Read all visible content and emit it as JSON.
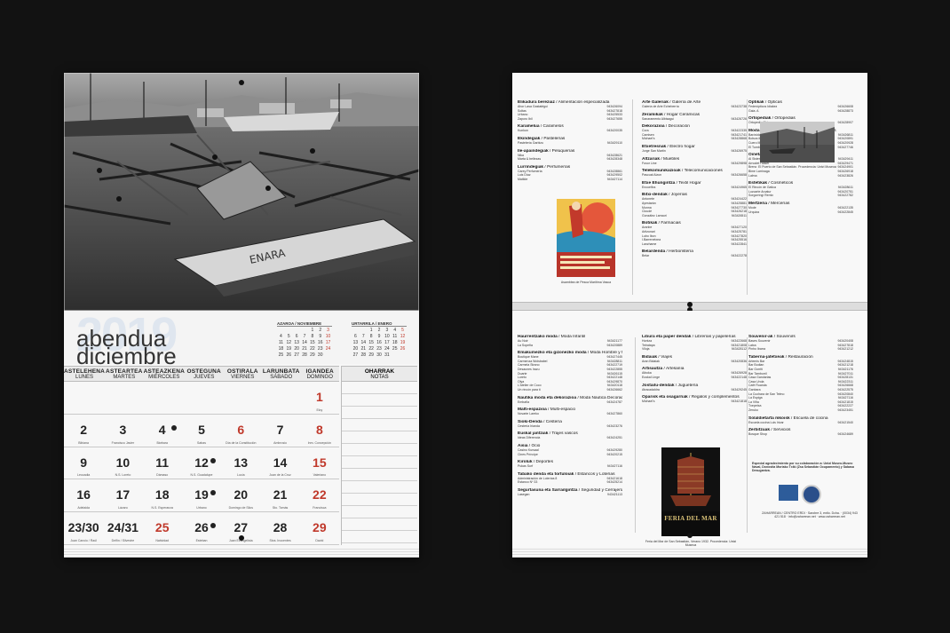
{
  "calendar": {
    "year": "2019",
    "month_eu": "abendua",
    "month_es": "diciembre",
    "mini_prev": {
      "title": "AZAROA / NOVIEMBRE",
      "rows": [
        [
          "",
          "",
          "",
          "",
          "1",
          "2",
          "3"
        ],
        [
          "4",
          "5",
          "6",
          "7",
          "8",
          "9",
          "10"
        ],
        [
          "11",
          "12",
          "13",
          "14",
          "15",
          "16",
          "17"
        ],
        [
          "18",
          "19",
          "20",
          "21",
          "22",
          "23",
          "24"
        ],
        [
          "25",
          "26",
          "27",
          "28",
          "29",
          "30",
          ""
        ]
      ]
    },
    "mini_next": {
      "title": "URTARRILA / ENERO",
      "rows": [
        [
          "",
          "",
          "1",
          "2",
          "3",
          "4",
          "5"
        ],
        [
          "6",
          "7",
          "8",
          "9",
          "10",
          "11",
          "12"
        ],
        [
          "13",
          "14",
          "15",
          "16",
          "17",
          "18",
          "19"
        ],
        [
          "20",
          "21",
          "22",
          "23",
          "24",
          "25",
          "26"
        ],
        [
          "27",
          "28",
          "29",
          "30",
          "31",
          "",
          ""
        ]
      ]
    },
    "weekdays": [
      {
        "eu": "ASTELEHENA",
        "es": "LUNES"
      },
      {
        "eu": "ASTEARTEA",
        "es": "MARTES"
      },
      {
        "eu": "ASTEAZKENA",
        "es": "MIÉRCOLES"
      },
      {
        "eu": "OSTEGUNA",
        "es": "JUEVES"
      },
      {
        "eu": "OSTIRALA",
        "es": "VIERNES"
      },
      {
        "eu": "LARUNBATA",
        "es": "SÁBADO"
      },
      {
        "eu": "IGANDEA",
        "es": "DOMINGO"
      }
    ],
    "notes": {
      "eu": "OHARRAK",
      "es": "NOTAS"
    },
    "days": [
      {
        "n": "",
        "s": ""
      },
      {
        "n": "",
        "s": ""
      },
      {
        "n": "",
        "s": ""
      },
      {
        "n": "",
        "s": ""
      },
      {
        "n": "",
        "s": ""
      },
      {
        "n": "",
        "s": ""
      },
      {
        "n": "1",
        "s": "Eloy"
      },
      {
        "n": "2",
        "s": "Bibiana"
      },
      {
        "n": "3",
        "s": "Francisco Javier"
      },
      {
        "n": "4",
        "s": "Bárbara"
      },
      {
        "n": "5",
        "s": "Sabas"
      },
      {
        "n": "6",
        "s": "Día de la Constitución"
      },
      {
        "n": "7",
        "s": "Ambrosio"
      },
      {
        "n": "8",
        "s": "Inm. Concepción"
      },
      {
        "n": "9",
        "s": "Leocadia"
      },
      {
        "n": "10",
        "s": "N.S. Loreto"
      },
      {
        "n": "11",
        "s": "Dámaso"
      },
      {
        "n": "12",
        "s": "N.S. Guadalupe"
      },
      {
        "n": "13",
        "s": "Lucía"
      },
      {
        "n": "14",
        "s": "Juan de la Cruz"
      },
      {
        "n": "15",
        "s": "Valeriano"
      },
      {
        "n": "16",
        "s": "Adelaida"
      },
      {
        "n": "17",
        "s": "Lázaro"
      },
      {
        "n": "18",
        "s": "N.S. Esperanza"
      },
      {
        "n": "19",
        "s": "Urbano"
      },
      {
        "n": "20",
        "s": "Domingo de Silos"
      },
      {
        "n": "21",
        "s": "Sto. Tomás"
      },
      {
        "n": "22",
        "s": "Francisca"
      },
      {
        "n": "23/30",
        "s": "Juan Cancio / Raúl"
      },
      {
        "n": "24/31",
        "s": "Delfín / Silvestre"
      },
      {
        "n": "25",
        "s": "Natividad"
      },
      {
        "n": "26",
        "s": "Esteban"
      },
      {
        "n": "27",
        "s": "Juan Evangelista"
      },
      {
        "n": "28",
        "s": "Stos. Inocentes"
      },
      {
        "n": "29",
        "s": "David"
      }
    ]
  },
  "directory": {
    "col1": [
      {
        "cat": "Elikadura bereziaz",
        "sub": "Alimentación especializada",
        "rows": [
          [
            "Ahor Lasa Gastatégui",
            "943426094"
          ],
          [
            "Soltas",
            "943427818"
          ],
          [
            "Urbano",
            "943425533"
          ],
          [
            "Zaporo Ibil",
            "943427655"
          ]
        ]
      },
      {
        "cat": "Karamelua",
        "sub": "Caramelos",
        "rows": [
          [
            "Kunkun",
            "943420035"
          ]
        ]
      },
      {
        "cat": "Ekindegiak",
        "sub": "Pastelerías",
        "rows": [
          [
            "Pastelería Garbizu",
            "943429110"
          ]
        ]
      },
      {
        "cat": "Ile-apaindegiak",
        "sub": "Peluquerías",
        "rows": [
          [
            "Nika",
            "943428621"
          ],
          [
            "Marta & bellezas",
            "943428348"
          ]
        ]
      },
      {
        "cat": "Lurrindegiak",
        "sub": "Perfumerías",
        "rows": [
          [
            "Carey Perfumería",
            "943428861"
          ],
          [
            "Luis Díaz",
            "943429502"
          ],
          [
            "Matilde",
            "943427114"
          ]
        ]
      }
    ],
    "col2": [
      {
        "cat": "Arte Galeriak",
        "sub": "Galería de Arte",
        "rows": [
          [
            "Galería de Arte Echeberría",
            "943423738"
          ]
        ]
      },
      {
        "cat": "Zeramikak",
        "sub": "Hogar Cerámicas",
        "rows": [
          [
            "Sanaramento Albisagui",
            "943426726"
          ]
        ]
      },
      {
        "cat": "Dekorazioa",
        "sub": "Decoración",
        "rows": [
          [
            "Cora",
            "943422335"
          ],
          [
            "Camisen",
            "943421741"
          ],
          [
            "Michael's",
            "943428868"
          ]
        ]
      },
      {
        "cat": "Etxetresnak",
        "sub": "Electro hogar",
        "rows": [
          [
            "Jorge San Martín",
            "943426975"
          ]
        ]
      },
      {
        "cat": "Altzariak",
        "sub": "Muebles",
        "rows": [
          [
            "Fusor Line",
            "943429898"
          ]
        ]
      },
      {
        "cat": "Telekomunikazioak",
        "sub": "Telecomunicaciones",
        "rows": [
          [
            "Pascual Aizun",
            "943426658"
          ]
        ]
      },
      {
        "cat": "Etxe Ehungintza",
        "sub": "Textil Hogar",
        "rows": [
          [
            "Encuelfos",
            "943424965"
          ]
        ]
      },
      {
        "cat": "Bitxi-dendak",
        "sub": "Joyerías",
        "rows": [
          [
            "Antonete",
            "943424422"
          ],
          [
            "Ayestarán",
            "943425881"
          ],
          [
            "Munna",
            "943427730"
          ],
          [
            "Cloudé",
            "943426218"
          ],
          [
            "González Larrauri",
            "943426511"
          ]
        ]
      },
      {
        "cat": "Botikak",
        "sub": "Farmacias",
        "rows": [
          [
            "Aranbe",
            "943427120"
          ],
          [
            "Aritzunari",
            "943425781"
          ],
          [
            "Lubo Ibon",
            "943427820"
          ],
          [
            "I.Barrenetxea",
            "943425516"
          ],
          [
            "Lanzhame",
            "943422841"
          ]
        ]
      },
      {
        "cat": "Belardenda",
        "sub": "Herboristería",
        "rows": [
          [
            "Belar",
            "943422278"
          ]
        ]
      }
    ],
    "col3": [
      {
        "cat": "Optikak",
        "sub": "Ópticas",
        "rows": [
          [
            "Federópticos Idiakez",
            "943426608"
          ],
          [
            "Gaia. A",
            "943428873"
          ]
        ]
      },
      {
        "cat": "Ortopediak",
        "sub": "Ortopedias",
        "rows": [
          [
            "Ortopedia Ohiz",
            "943428907"
          ]
        ]
      },
      {
        "cat": "Moda eta osagarriak",
        "sub": "Moda y complementos",
        "rows": [
          [
            "Baróvida",
            "943426811"
          ],
          [
            "Bolsos ibiza",
            "943420891"
          ],
          [
            "Cuero Moda",
            "943420928"
          ],
          [
            "El Tumbo",
            "943427746"
          ]
        ]
      },
      {
        "cat": "Oinetakoak",
        "sub": "Calzado",
        "rows": [
          [
            "Al Sistem",
            "943429411"
          ],
          [
            "Arnodet Hasier",
            "943429471"
          ],
          [
            "Breno",
            "943424901"
          ],
          [
            "Bime Larrinaga",
            "943426918"
          ],
          [
            "Lalma",
            "943423826"
          ]
        ]
      },
      {
        "cat": "Estetikak",
        "sub": "Cosméticos",
        "rows": [
          [
            "El Rincón de Gatica",
            "943428611"
          ],
          [
            "Luzcarte Arcatur",
            "943420751"
          ],
          [
            "Sorgorringi Remix",
            "943422782"
          ]
        ]
      },
      {
        "cat": "Mertzeria",
        "sub": "Mercerías",
        "rows": [
          [
            "Mode",
            "943422135"
          ],
          [
            "Urquiza",
            "943422845"
          ]
        ]
      }
    ],
    "poster1_caption": "Asamblea de Pesca Marítima Vasca",
    "photo2_caption": "El Puerto de San Sebastián. Procedencia: Untzi Museoa",
    "col4": [
      {
        "cat": "Haurrentzako moda",
        "sub": "Moda Infantil",
        "rows": [
          [
            "Au Noir",
            "943421177"
          ],
          [
            "La Sopeña",
            "943420889"
          ]
        ]
      },
      {
        "cat": "Emakumezko eta gizonezko moda",
        "sub": "Moda Hombre y Mujer",
        "rows": [
          [
            "Boutique Mane",
            "943427445"
          ],
          [
            "Carmenza Wolsbabel",
            "943428811"
          ],
          [
            "Carmela Strano",
            "943422719"
          ],
          [
            "Desaunes Irazu",
            "943422855"
          ],
          [
            "Duarte",
            "943426115"
          ],
          [
            "Loreto",
            "943422148"
          ],
          [
            "Olya",
            "943429870"
          ],
          [
            "L'Atelier de Coco",
            "943420118"
          ],
          [
            "Un rincón para ti",
            "943426662"
          ]
        ]
      },
      {
        "cat": "Nautika moda eta dekorazioa",
        "sub": "Moda Náutica Decoración",
        "rows": [
          [
            "Embaña",
            "943424787"
          ]
        ]
      },
      {
        "cat": "Malti-espazioa",
        "sub": "Multi-espacio",
        "rows": [
          [
            "Novarte Lareko",
            "943427860"
          ]
        ]
      },
      {
        "cat": "Sioki-Denda",
        "sub": "Cestería",
        "rows": [
          [
            "Cestería Irianda",
            "943423276"
          ]
        ]
      },
      {
        "cat": "Euskal jantziak",
        "sub": "Trajes vascos",
        "rows": [
          [
            "Ideas Diferencia",
            "943424251"
          ]
        ]
      },
      {
        "cat": "Aisia",
        "sub": "Ocio",
        "rows": [
          [
            "Casino Kursaal",
            "943429280"
          ],
          [
            "Cines Príncipe",
            "943420215"
          ]
        ]
      },
      {
        "cat": "Kiroluk",
        "sub": "Deportes",
        "rows": [
          [
            "Pukas Surf",
            "943427116"
          ]
        ]
      },
      {
        "cat": "Tabako denda eta tortuloiak",
        "sub": "Estancos y Loterías",
        "rows": [
          [
            "Administración de Loterías 8",
            "943421618"
          ],
          [
            "Estanco Nº 33",
            "943425214"
          ]
        ]
      },
      {
        "cat": "Segurtasuna eta Sarrailgintza",
        "sub": "Seguridad y Cerrajería",
        "rows": [
          [
            "Lasegan",
            "943421113"
          ]
        ]
      }
    ],
    "col5": [
      {
        "cat": "Libura eta paper dendak",
        "sub": "Librerías y papelerías",
        "rows": [
          [
            "Hontza",
            "943422668"
          ],
          [
            "Tetratapa",
            "943421808"
          ],
          [
            "Viloja",
            "943428112"
          ]
        ]
      },
      {
        "cat": "Bidaiak",
        "sub": "Viajes",
        "rows": [
          [
            "Aran Bidaiak",
            "943420836"
          ]
        ]
      },
      {
        "cat": "Artisautza",
        "sub": "Artesanía",
        "rows": [
          [
            "Aiboka",
            "943426928"
          ],
          [
            "Euskal Linge",
            "943422148"
          ]
        ]
      },
      {
        "cat": "Jostailu-dendak",
        "sub": "Juguetería",
        "rows": [
          [
            "Atracadaldra",
            "943429245"
          ]
        ]
      },
      {
        "cat": "Oparisk eta osagarriak",
        "sub": "Regalos y complementos",
        "rows": [
          [
            "Michael's",
            "943421818"
          ]
        ]
      }
    ],
    "poster2_title": "FERIA DEL MAR",
    "poster2_caption": "Feria del Mar de San Sebastián, Verano 1932. Procedencia: Untzi Museoa",
    "col6": [
      {
        "cat": "Souvenir-ak",
        "sub": "Souvenirs",
        "rows": [
          [
            "Bases Souvenir",
            "943420408"
          ],
          [
            "Latxa",
            "943427818"
          ],
          [
            "Pinho Ibarra",
            "943421212"
          ]
        ]
      },
      {
        "cat": "Taberna-jatetxeak",
        "sub": "Restauración",
        "rows": [
          [
            "Artemis Bar",
            "943424815"
          ],
          [
            "Bar Bodian",
            "943421218"
          ],
          [
            "Bar Gorriti",
            "943421176"
          ],
          [
            "Bar Tamborril",
            "943427011"
          ],
          [
            "Casa Gandarias",
            "943428131"
          ],
          [
            "Casa Urola",
            "943422311"
          ],
          [
            "Café Ruanda",
            "943426668"
          ],
          [
            "Ganbara",
            "943422575"
          ],
          [
            "La Cuchara de San Telmo",
            "943420840"
          ],
          [
            "La Espiga",
            "943427116"
          ],
          [
            "La Viña",
            "943421815"
          ],
          [
            "Txepetxa",
            "943422227"
          ],
          [
            "Zeruko",
            "943423451"
          ]
        ]
      },
      {
        "cat": "Solaldietarta mkoisk",
        "sub": "Escuela de cocina",
        "rows": [
          [
            "Escuela cocina Luis Irizar",
            "943421540"
          ]
        ]
      },
      {
        "cat": "Zerbitzuak",
        "sub": "Servicios",
        "rows": [
          [
            "Bosque Shop",
            "943424689"
          ]
        ]
      }
    ],
    "thanks": "Especial agradecimiento por su colaboración a: Untzi Museo-Museo Naval, Donostia Moriako Txiki (Zsa Sebastián Ocupamento) y Sabasa Desugantza.",
    "footer": "ZAHARREAN / CENTRO ERDI · Sarobre 3, entlo. Dcha. · (0034) 943 421 518 · info@zaharrean.net · www.zaharrean.net"
  }
}
